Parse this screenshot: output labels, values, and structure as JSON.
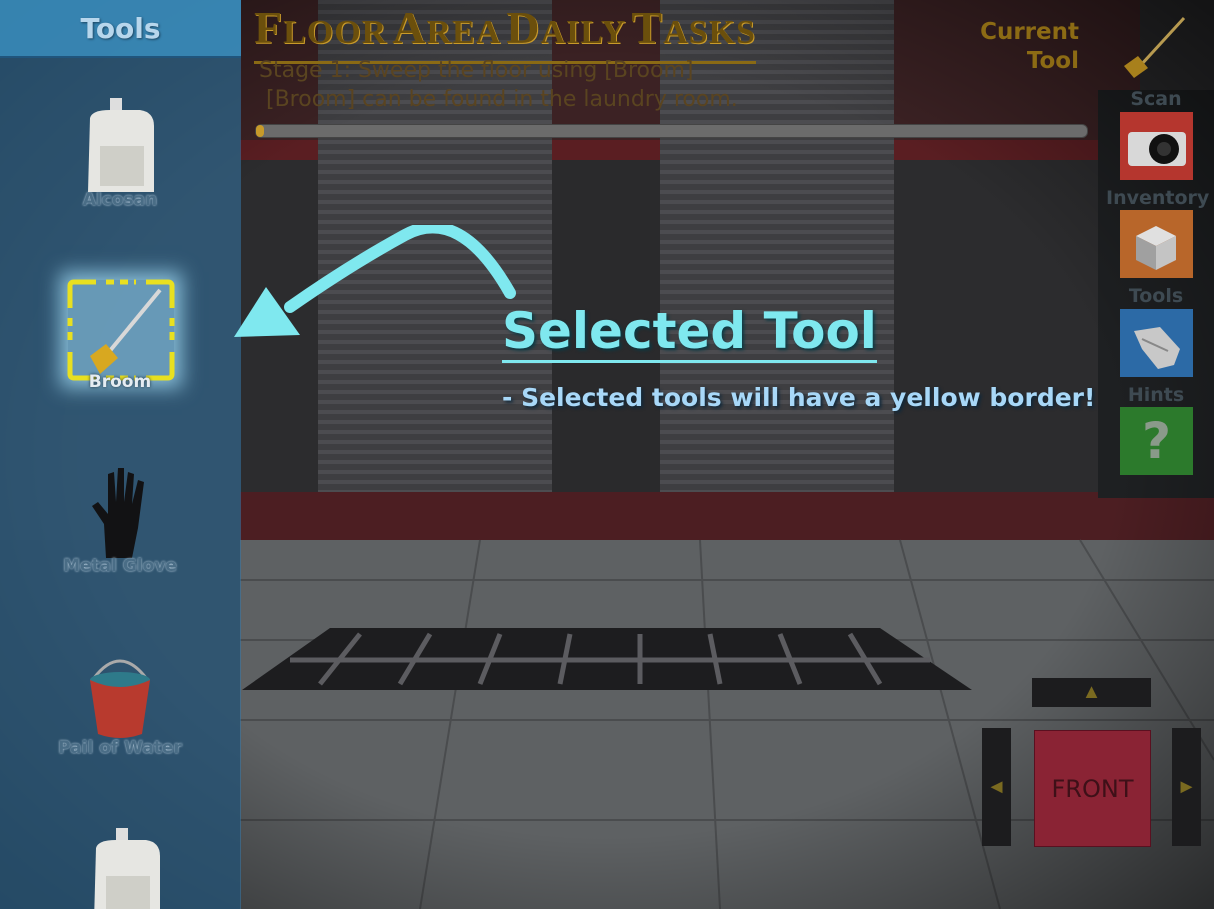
{
  "tools_panel": {
    "title": "Tools",
    "items": [
      {
        "label": "Alcosan",
        "icon": "bottle-icon"
      },
      {
        "label": "Broom",
        "icon": "broom-icon",
        "selected": true
      },
      {
        "label": "Metal Glove",
        "icon": "metal-glove-icon"
      },
      {
        "label": "Pail of Water",
        "icon": "pail-icon"
      },
      {
        "label": "",
        "icon": "bottle-icon"
      }
    ]
  },
  "task": {
    "title_caps": [
      "F",
      "A",
      "D",
      "T"
    ],
    "title_rest": [
      "LOOR",
      "REA",
      "AILY",
      "ASKS"
    ],
    "stage": "Stage 1: Sweep the floor using [Broom]",
    "hint": " [Broom] can be found in the laundry room.",
    "progress": 0.01
  },
  "current_tool": {
    "line1": "Current",
    "line2": "Tool",
    "icon": "broom-icon"
  },
  "side_menu": [
    {
      "label": "Scan",
      "icon": "camera-icon",
      "color": "#b5362e"
    },
    {
      "label": "Inventory",
      "icon": "box-icon",
      "color": "#b8662a"
    },
    {
      "label": "Tools",
      "icon": "glove-icon",
      "color": "#2c6aa6"
    },
    {
      "label": "Hints",
      "icon": "question-icon",
      "color": "#2c7a2c"
    }
  ],
  "callout": {
    "title": "Selected Tool",
    "description": "- Selected tools will have a yellow border!"
  },
  "navigation": {
    "front_label": "FRONT",
    "up_arrow": "▲",
    "left_arrow": "◄",
    "right_arrow": "►"
  },
  "colors": {
    "selection_border": "#e8e020",
    "callout": "#7fe8ef",
    "title": "#6b4f0c"
  }
}
